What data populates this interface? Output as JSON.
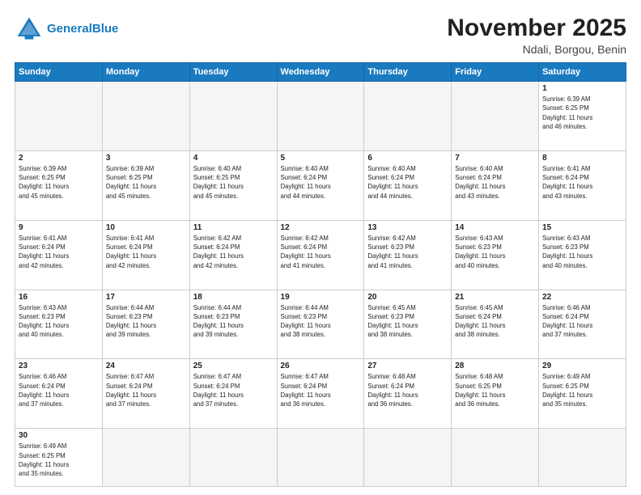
{
  "header": {
    "logo_general": "General",
    "logo_blue": "Blue",
    "month": "November 2025",
    "location": "Ndali, Borgou, Benin"
  },
  "days_of_week": [
    "Sunday",
    "Monday",
    "Tuesday",
    "Wednesday",
    "Thursday",
    "Friday",
    "Saturday"
  ],
  "weeks": [
    [
      {
        "day": "",
        "info": ""
      },
      {
        "day": "",
        "info": ""
      },
      {
        "day": "",
        "info": ""
      },
      {
        "day": "",
        "info": ""
      },
      {
        "day": "",
        "info": ""
      },
      {
        "day": "",
        "info": ""
      },
      {
        "day": "1",
        "info": "Sunrise: 6:39 AM\nSunset: 6:25 PM\nDaylight: 11 hours\nand 46 minutes."
      }
    ],
    [
      {
        "day": "2",
        "info": "Sunrise: 6:39 AM\nSunset: 6:25 PM\nDaylight: 11 hours\nand 45 minutes."
      },
      {
        "day": "3",
        "info": "Sunrise: 6:39 AM\nSunset: 6:25 PM\nDaylight: 11 hours\nand 45 minutes."
      },
      {
        "day": "4",
        "info": "Sunrise: 6:40 AM\nSunset: 6:25 PM\nDaylight: 11 hours\nand 45 minutes."
      },
      {
        "day": "5",
        "info": "Sunrise: 6:40 AM\nSunset: 6:24 PM\nDaylight: 11 hours\nand 44 minutes."
      },
      {
        "day": "6",
        "info": "Sunrise: 6:40 AM\nSunset: 6:24 PM\nDaylight: 11 hours\nand 44 minutes."
      },
      {
        "day": "7",
        "info": "Sunrise: 6:40 AM\nSunset: 6:24 PM\nDaylight: 11 hours\nand 43 minutes."
      },
      {
        "day": "8",
        "info": "Sunrise: 6:41 AM\nSunset: 6:24 PM\nDaylight: 11 hours\nand 43 minutes."
      }
    ],
    [
      {
        "day": "9",
        "info": "Sunrise: 6:41 AM\nSunset: 6:24 PM\nDaylight: 11 hours\nand 42 minutes."
      },
      {
        "day": "10",
        "info": "Sunrise: 6:41 AM\nSunset: 6:24 PM\nDaylight: 11 hours\nand 42 minutes."
      },
      {
        "day": "11",
        "info": "Sunrise: 6:42 AM\nSunset: 6:24 PM\nDaylight: 11 hours\nand 42 minutes."
      },
      {
        "day": "12",
        "info": "Sunrise: 6:42 AM\nSunset: 6:24 PM\nDaylight: 11 hours\nand 41 minutes."
      },
      {
        "day": "13",
        "info": "Sunrise: 6:42 AM\nSunset: 6:23 PM\nDaylight: 11 hours\nand 41 minutes."
      },
      {
        "day": "14",
        "info": "Sunrise: 6:43 AM\nSunset: 6:23 PM\nDaylight: 11 hours\nand 40 minutes."
      },
      {
        "day": "15",
        "info": "Sunrise: 6:43 AM\nSunset: 6:23 PM\nDaylight: 11 hours\nand 40 minutes."
      }
    ],
    [
      {
        "day": "16",
        "info": "Sunrise: 6:43 AM\nSunset: 6:23 PM\nDaylight: 11 hours\nand 40 minutes."
      },
      {
        "day": "17",
        "info": "Sunrise: 6:44 AM\nSunset: 6:23 PM\nDaylight: 11 hours\nand 39 minutes."
      },
      {
        "day": "18",
        "info": "Sunrise: 6:44 AM\nSunset: 6:23 PM\nDaylight: 11 hours\nand 39 minutes."
      },
      {
        "day": "19",
        "info": "Sunrise: 6:44 AM\nSunset: 6:23 PM\nDaylight: 11 hours\nand 38 minutes."
      },
      {
        "day": "20",
        "info": "Sunrise: 6:45 AM\nSunset: 6:23 PM\nDaylight: 11 hours\nand 38 minutes."
      },
      {
        "day": "21",
        "info": "Sunrise: 6:45 AM\nSunset: 6:24 PM\nDaylight: 11 hours\nand 38 minutes."
      },
      {
        "day": "22",
        "info": "Sunrise: 6:46 AM\nSunset: 6:24 PM\nDaylight: 11 hours\nand 37 minutes."
      }
    ],
    [
      {
        "day": "23",
        "info": "Sunrise: 6:46 AM\nSunset: 6:24 PM\nDaylight: 11 hours\nand 37 minutes."
      },
      {
        "day": "24",
        "info": "Sunrise: 6:47 AM\nSunset: 6:24 PM\nDaylight: 11 hours\nand 37 minutes."
      },
      {
        "day": "25",
        "info": "Sunrise: 6:47 AM\nSunset: 6:24 PM\nDaylight: 11 hours\nand 37 minutes."
      },
      {
        "day": "26",
        "info": "Sunrise: 6:47 AM\nSunset: 6:24 PM\nDaylight: 11 hours\nand 36 minutes."
      },
      {
        "day": "27",
        "info": "Sunrise: 6:48 AM\nSunset: 6:24 PM\nDaylight: 11 hours\nand 36 minutes."
      },
      {
        "day": "28",
        "info": "Sunrise: 6:48 AM\nSunset: 6:25 PM\nDaylight: 11 hours\nand 36 minutes."
      },
      {
        "day": "29",
        "info": "Sunrise: 6:49 AM\nSunset: 6:25 PM\nDaylight: 11 hours\nand 35 minutes."
      }
    ],
    [
      {
        "day": "30",
        "info": "Sunrise: 6:49 AM\nSunset: 6:25 PM\nDaylight: 11 hours\nand 35 minutes."
      },
      {
        "day": "",
        "info": ""
      },
      {
        "day": "",
        "info": ""
      },
      {
        "day": "",
        "info": ""
      },
      {
        "day": "",
        "info": ""
      },
      {
        "day": "",
        "info": ""
      },
      {
        "day": "",
        "info": ""
      }
    ]
  ]
}
